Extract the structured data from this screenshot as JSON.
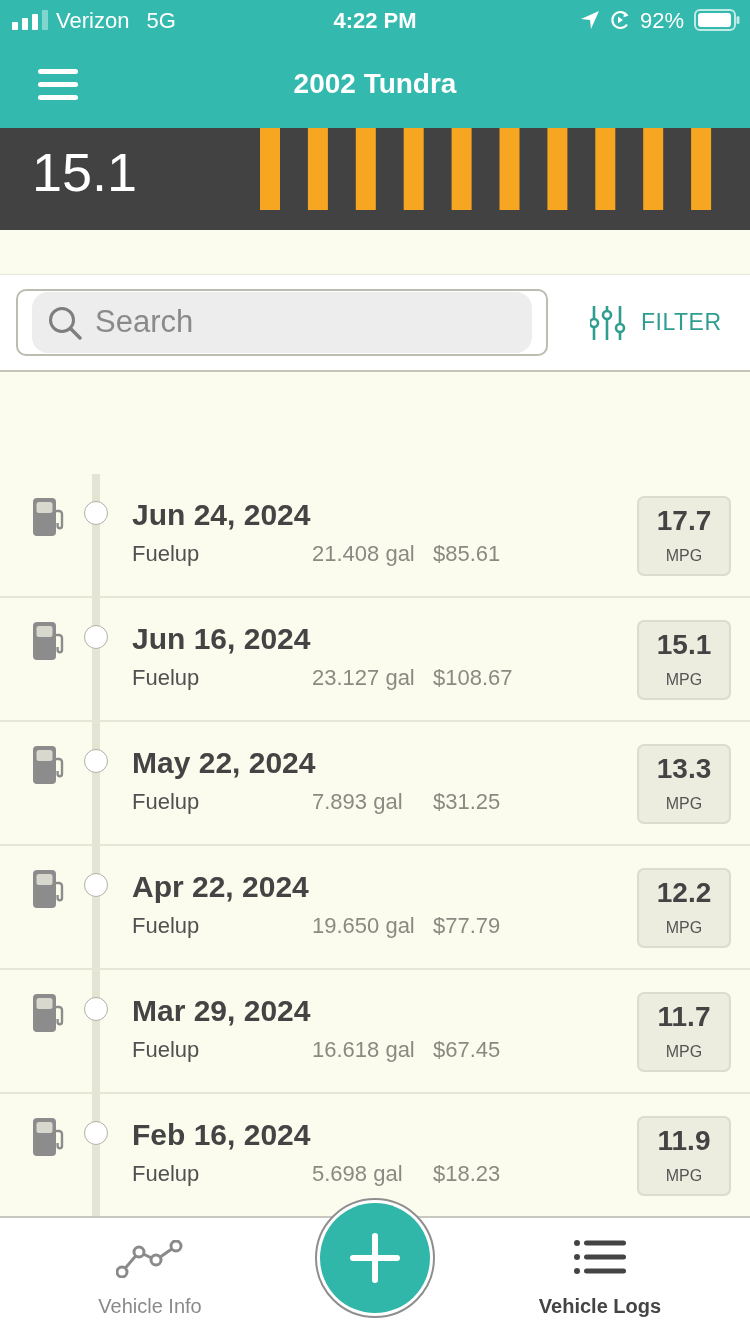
{
  "status_bar": {
    "carrier": "Verizon",
    "network": "5G",
    "time": "4:22 PM",
    "battery": "92%"
  },
  "header": {
    "title": "2002 Tundra"
  },
  "summary": {
    "value": "15.1"
  },
  "search": {
    "placeholder": "Search"
  },
  "filter": {
    "label": "FILTER"
  },
  "logs": [
    {
      "date": "Jun 24, 2024",
      "type": "Fuelup",
      "gallons": "21.408 gal",
      "cost": "$85.61",
      "mpg": "17.7",
      "unit": "MPG"
    },
    {
      "date": "Jun 16, 2024",
      "type": "Fuelup",
      "gallons": "23.127 gal",
      "cost": "$108.67",
      "mpg": "15.1",
      "unit": "MPG"
    },
    {
      "date": "May 22, 2024",
      "type": "Fuelup",
      "gallons": "7.893 gal",
      "cost": "$31.25",
      "mpg": "13.3",
      "unit": "MPG"
    },
    {
      "date": "Apr 22, 2024",
      "type": "Fuelup",
      "gallons": "19.650 gal",
      "cost": "$77.79",
      "mpg": "12.2",
      "unit": "MPG"
    },
    {
      "date": "Mar 29, 2024",
      "type": "Fuelup",
      "gallons": "16.618 gal",
      "cost": "$67.45",
      "mpg": "11.7",
      "unit": "MPG"
    },
    {
      "date": "Feb 16, 2024",
      "type": "Fuelup",
      "gallons": "5.698 gal",
      "cost": "$18.23",
      "mpg": "11.9",
      "unit": "MPG"
    }
  ],
  "tab_bar": {
    "tabs": [
      {
        "label": "Vehicle Info",
        "selected": false
      },
      {
        "label": "Vehicle Logs",
        "selected": true
      }
    ]
  }
}
